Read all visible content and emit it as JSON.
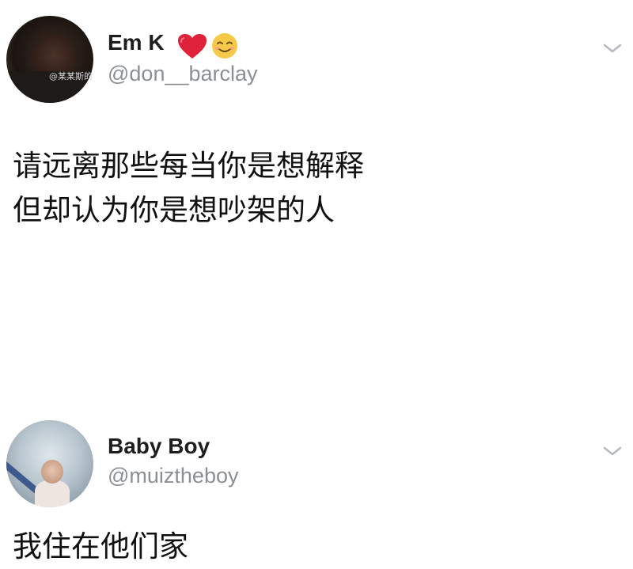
{
  "tweets": [
    {
      "display_name": "Em K",
      "name_icons": [
        "red-heart-icon",
        "smiling-face-icon"
      ],
      "handle": "@don__barclay",
      "watermark": "@某某斯的",
      "text_lines": [
        "请远离那些每当你是想解释",
        "但却认为你是想吵架的人"
      ],
      "menu_icon": "chevron-down-icon"
    },
    {
      "display_name": "Baby Boy",
      "handle": "@muiztheboy",
      "text_lines": [
        "我住在他们家"
      ],
      "menu_icon": "chevron-down-icon"
    }
  ],
  "colors": {
    "background": "#ffffff",
    "name": "#1e1e1e",
    "handle": "#8a8f94",
    "text": "#111111",
    "heart": "#e0213a",
    "chevron": "#b5b9bd"
  }
}
